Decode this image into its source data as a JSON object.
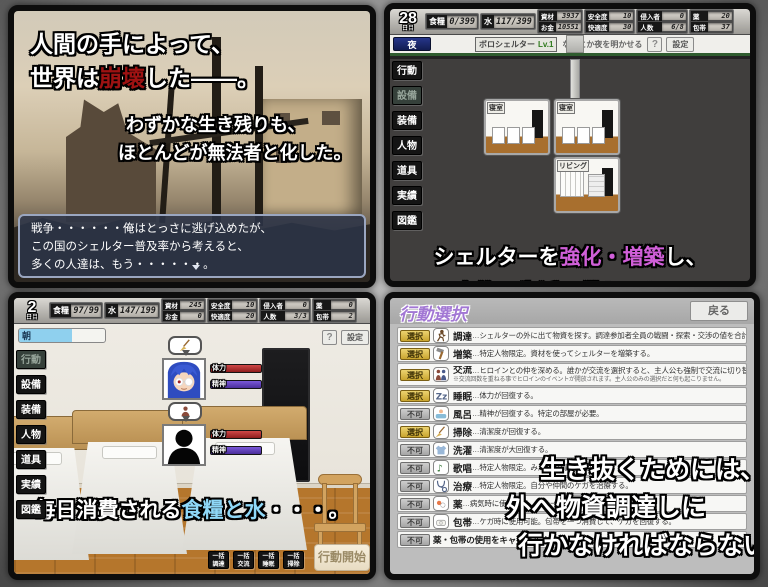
{
  "colors": {
    "highlight_red": "#9e1212",
    "highlight_magenta": "#d05fd8",
    "highlight_cyan": "#8fd8f8",
    "select_gold": "#c9a52f",
    "night_navy": "#1c2b6e",
    "day_blue": "#8fd0ee"
  },
  "tabs": [
    "行動",
    "設備",
    "装備",
    "人物",
    "道具",
    "実績",
    "図鑑"
  ],
  "hud_labels": {
    "food": "食糧",
    "water": "水",
    "materials": "資材",
    "money": "お金",
    "safety": "安全度",
    "comfort": "快適度",
    "intruder": "侵入者",
    "people": "人数",
    "medicine": "薬",
    "bandage": "包帯",
    "day_suffix": "日目"
  },
  "intro": {
    "line1": "人間の手によって、",
    "line2_pre": "世界は",
    "line2_hl": "崩壊",
    "line2_post": "した——。",
    "line3": "わずかな生き残りも、",
    "line4": "ほとんどが無法者と化した。",
    "dialog": [
      "戦争・・・・・・俺はとっさに逃げ込めたが、",
      "この国のシェルター普及率から考えると、",
      "多くの人達は、もう・・・・・・。"
    ]
  },
  "shelter": {
    "hud": {
      "day": "28",
      "time": "夜",
      "food": "0/399",
      "water": "117/399",
      "materials": "3937",
      "money": "10551",
      "safety": "10",
      "comfort": "30",
      "intruder": "0",
      "people": "6/8",
      "medicine": "20",
      "bandage": "37"
    },
    "info": {
      "name": "ボロシェルター",
      "level": "Lv.1",
      "desc": "なんとか夜を明かせる",
      "help": "?",
      "settings": "設定"
    },
    "rooms": [
      {
        "label": "寝室"
      },
      {
        "label": "寝室"
      },
      {
        "label": "リビング"
      }
    ],
    "caption": {
      "pre": "シェルターを",
      "hl": "強化・増築",
      "post": "し、",
      "line2": "今後の生活に備えよう！"
    }
  },
  "daily": {
    "hud": {
      "day": "2",
      "time": "朝",
      "food": "97/99",
      "water": "147/199",
      "materials": "245",
      "money": "0",
      "safety": "10",
      "comfort": "20",
      "intruder": "0",
      "people": "3/3",
      "medicine": "0",
      "bandage": "2"
    },
    "help": "?",
    "settings": "設定",
    "bars": {
      "hp": "体力",
      "mp": "精神"
    },
    "batch": [
      {
        "l1": "一括",
        "l2": "調達"
      },
      {
        "l1": "一括",
        "l2": "交流"
      },
      {
        "l1": "一括",
        "l2": "睡眠"
      },
      {
        "l1": "一括",
        "l2": "掃除"
      }
    ],
    "start": "行動開始",
    "caption": {
      "pre": "毎日消費される",
      "hl": "食糧と水",
      "post": "・・・。"
    }
  },
  "actions": {
    "title": "行動選択",
    "back": "戻る",
    "rows": [
      {
        "btn": "選択",
        "name": "調達",
        "desc": "…シェルターの外に出て物資を探す。調達参加者全員の戦闘・探索・交渉の値を合計する。"
      },
      {
        "btn": "選択",
        "name": "増築",
        "desc": "…特定人物限定。資材を使ってシェルターを増築する。"
      },
      {
        "btn": "選択",
        "name": "交流",
        "desc": "…ヒロインとの仲を深める。誰かが交流を選択すると、主人公も強制で交流に切り替わる。",
        "sub": "※交流回数を重ねる事でヒロインのイベントが開放されます。主人公のみの選択だと何も起こりません。"
      },
      {
        "btn": "選択",
        "name": "睡眠",
        "desc": "…体力が回復する。"
      },
      {
        "btn": "不可",
        "name": "風呂",
        "desc": "…精神が回復する。特定の部屋が必要。"
      },
      {
        "btn": "選択",
        "name": "掃除",
        "desc": "…清潔度が回復する。"
      },
      {
        "btn": "不可",
        "name": "洗濯",
        "desc": "…清潔度が大回復する。"
      },
      {
        "btn": "不可",
        "name": "歌唱",
        "desc": "…特定人物限定。みんなの精神を回復する。"
      },
      {
        "btn": "不可",
        "name": "治療",
        "desc": "…特定人物限定。自分や仲間のケガを治療する。"
      },
      {
        "btn": "不可",
        "name": "薬",
        "desc": "…病気時に使用可能。薬を一つ消費して、病気を回復する。"
      },
      {
        "btn": "不可",
        "name": "包帯",
        "desc": "…ケガ時に使用可能。包帯を一つ消費して、ケガを回復する。"
      },
      {
        "btn": "不可",
        "name": "",
        "desc": "薬・包帯の使用をキャンセルする。"
      }
    ],
    "caption": [
      "生き抜くためには、",
      "外へ物資調達しに",
      "行かなければならない。"
    ]
  }
}
